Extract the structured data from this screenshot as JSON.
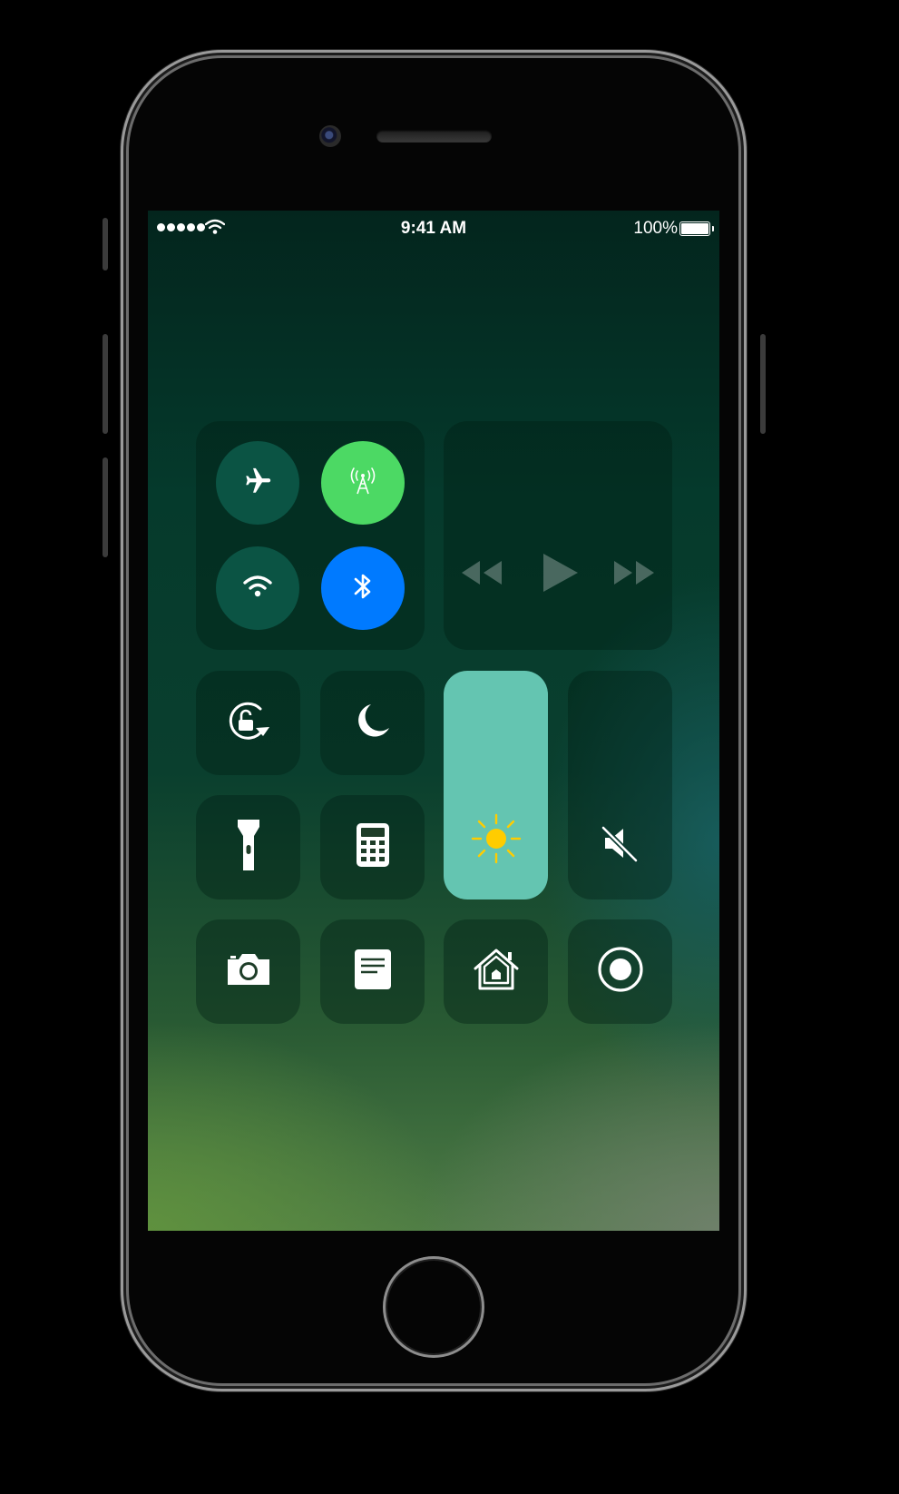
{
  "status_bar": {
    "time": "9:41 AM",
    "battery_percent": "100%",
    "signal_bars": 5,
    "icons": [
      "signal-dots-icon",
      "wifi-icon",
      "battery-icon"
    ]
  },
  "connectivity": {
    "airplane_mode": {
      "icon": "airplane-icon",
      "on": false,
      "color": "#0b5444"
    },
    "cellular_data": {
      "icon": "cellular-antenna-icon",
      "on": true,
      "color": "#4cd964"
    },
    "wifi": {
      "icon": "wifi-icon",
      "on": false,
      "color": "#0b5444"
    },
    "bluetooth": {
      "icon": "bluetooth-icon",
      "on": true,
      "color": "#007aff"
    }
  },
  "media": {
    "icons": [
      "rewind-icon",
      "play-icon",
      "fast-forward-icon"
    ]
  },
  "toggles": [
    {
      "id": "orientation-lock",
      "icon": "rotation-lock-icon"
    },
    {
      "id": "do-not-disturb",
      "icon": "moon-icon"
    },
    {
      "id": "flashlight",
      "icon": "flashlight-icon"
    },
    {
      "id": "calculator",
      "icon": "calculator-icon"
    },
    {
      "id": "camera",
      "icon": "camera-icon"
    },
    {
      "id": "notes",
      "icon": "notes-icon"
    },
    {
      "id": "home",
      "icon": "home-icon"
    },
    {
      "id": "screen-recording",
      "icon": "record-icon"
    }
  ],
  "brightness": {
    "icon": "sun-icon",
    "level": 1.0,
    "fill_color": "#64c5b1",
    "icon_color": "#ffcc00"
  },
  "volume": {
    "icon": "speaker-muted-icon",
    "level": 0.0
  }
}
